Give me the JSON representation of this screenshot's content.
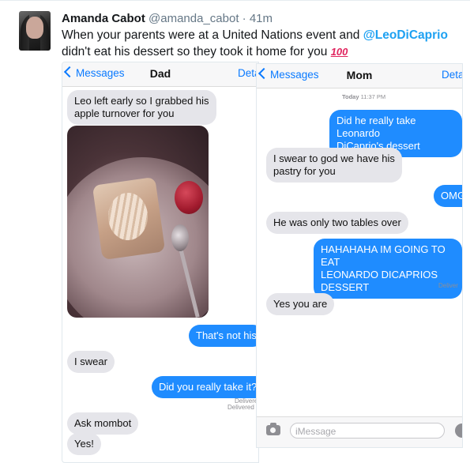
{
  "tweet": {
    "name": "Amanda Cabot",
    "handle": "@amanda_cabot",
    "separator": "·",
    "time": "41m",
    "text_part1": "When your parents were at a United Nations event and ",
    "mention": "@LeoDiCaprio",
    "text_part2": " didn't eat his dessert so they took it home for you ",
    "emoji": "100"
  },
  "left_chat": {
    "back_label": "Messages",
    "title": "Dad",
    "right_label": "Deta",
    "messages": [
      {
        "text": "Leo left early so I grabbed his\napple turnover for you"
      },
      {
        "text": "That's not his"
      },
      {
        "text": "I swear"
      },
      {
        "text": "Did you really take it??"
      },
      {
        "text": "Ask mombot"
      },
      {
        "text": "Yes!"
      }
    ],
    "delivered1": "Delivere",
    "delivered2": "Delivered"
  },
  "right_chat": {
    "back_label": "Messages",
    "title": "Mom",
    "right_label": "Deta",
    "timestamp_day": "Today",
    "timestamp_time": "11:37 PM",
    "messages": [
      {
        "text": "Did he really take Leonardo\nDiCaprio's dessert"
      },
      {
        "text": "I swear to god we have his\npastry for you"
      },
      {
        "text": "OMG"
      },
      {
        "text": "He was only two tables over"
      },
      {
        "text": "HAHAHAHA IM GOING TO EAT\nLEONARDO DICAPRIOS\nDESSERT"
      },
      {
        "text": "Yes you are"
      }
    ],
    "delivered": "Deliver",
    "input_placeholder": "iMessage"
  }
}
